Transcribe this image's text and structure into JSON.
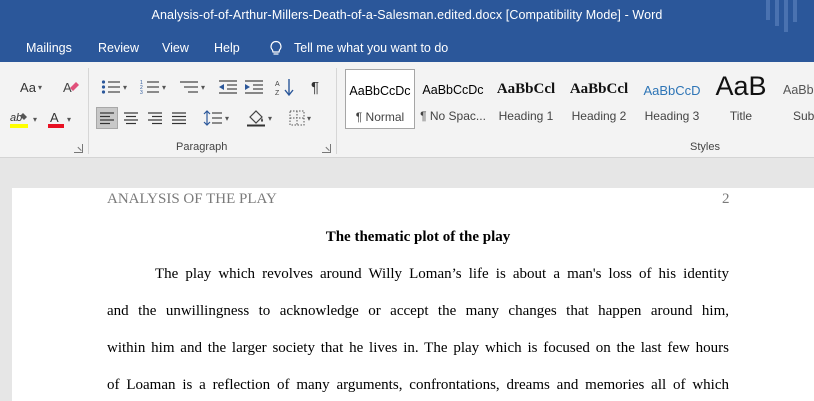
{
  "window": {
    "title": "Analysis-of-of-Arthur-Millers-Death-of-a-Salesman.edited.docx [Compatibility Mode]  -  Word"
  },
  "menu": {
    "items": [
      "Mailings",
      "Review",
      "View",
      "Help"
    ],
    "tell_me": "Tell me what you want to do"
  },
  "ribbon": {
    "font_case_label": "Aa",
    "paragraph_group": "Paragraph",
    "styles_group": "Styles",
    "styles": [
      {
        "sample": "AaBbCcDc",
        "name": "¶ Normal"
      },
      {
        "sample": "AaBbCcDc",
        "name": "¶ No Spac..."
      },
      {
        "sample": "AaBbCcl",
        "name": "Heading 1"
      },
      {
        "sample": "AaBbCcl",
        "name": "Heading 2"
      },
      {
        "sample": "AaBbCcD",
        "name": "Heading 3"
      },
      {
        "sample": "AaB",
        "name": "Title"
      },
      {
        "sample": "AaBb",
        "name": "Subt"
      }
    ],
    "colors": {
      "highlight": "#ffff00",
      "font_color": "#e81123",
      "accent": "#2b579a"
    }
  },
  "document": {
    "header": "ANALYSIS OF THE PLAY",
    "page_number": "2",
    "heading": "The thematic plot of the play",
    "lines": [
      "The play which revolves around  Willy Loman’s life is about a man's loss of his identity",
      "and the unwillingness to acknowledge or accept the many changes that happen around him,",
      "within him and the larger society that he lives in. The play which is focused on the last few hours",
      "of Loaman is a reflection of many arguments, confrontations, dreams and memories all of which"
    ]
  }
}
